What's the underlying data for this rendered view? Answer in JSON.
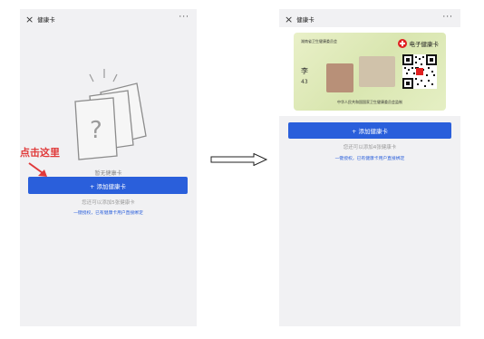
{
  "left_screen": {
    "title": "健康卡",
    "close_icon": "×",
    "more_icon": "···",
    "empty_text": "暂无健康卡",
    "add_button": "+ 添加健康卡",
    "hint": "您还可以添加5张健康卡",
    "link": "一键授权，已有健康卡用户直接绑定",
    "annotation": "点击这里"
  },
  "right_screen": {
    "title": "健康卡",
    "close_icon": "×",
    "more_icon": "···",
    "card": {
      "issuer": "湖南省卫生健康委员会",
      "title": "电子健康卡",
      "holder_name": "李",
      "holder_id": "43",
      "ministry": "中华人民共和国国家卫生健康委员会监制"
    },
    "add_button": "+ 添加健康卡",
    "hint": "您还可以添加4张健康卡",
    "link": "一键授权，已有健康卡用户直接绑定"
  },
  "colors": {
    "accent": "#2a5fdb",
    "annotation": "#e03a3a",
    "card_bg": "#e2ecbe",
    "screen_bg": "#f1f1f3"
  }
}
